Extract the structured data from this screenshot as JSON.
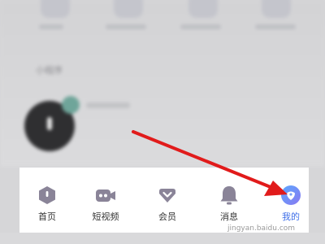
{
  "background": {
    "section_title": "小程序"
  },
  "tabbar": {
    "tabs": [
      {
        "label": "首页",
        "icon": "home-icon"
      },
      {
        "label": "短视频",
        "icon": "video-camera-icon"
      },
      {
        "label": "会员",
        "icon": "member-icon"
      },
      {
        "label": "消息",
        "icon": "bell-icon"
      },
      {
        "label": "我的",
        "icon": "my-profile-icon",
        "active": true
      }
    ]
  },
  "annotation": {
    "arrow_color": "#e11b1b"
  },
  "colors": {
    "icon_gray": "#8a8498",
    "active_blue": "#3f6fe8",
    "active_gradient": [
      "#5ba8ff",
      "#8a78f0"
    ]
  },
  "watermark": "jingyan.baidu.com"
}
